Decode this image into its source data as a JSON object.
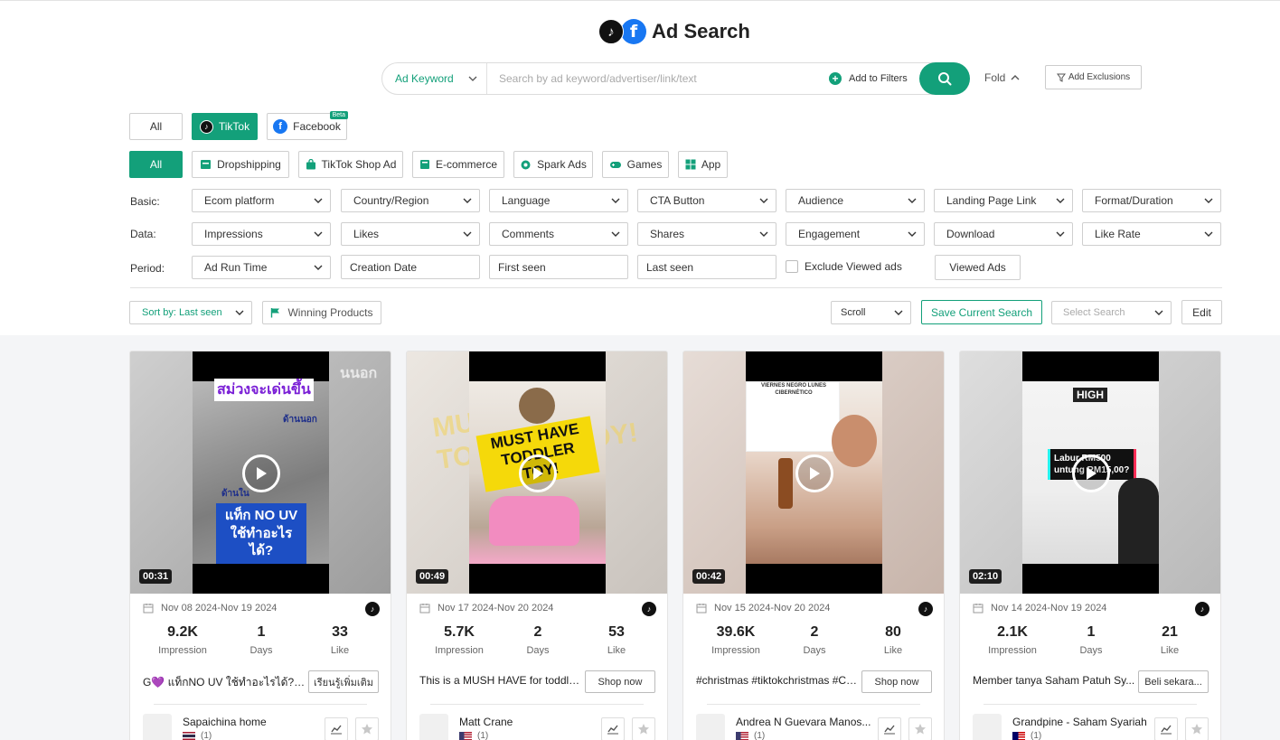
{
  "header": {
    "title": "Ad Search"
  },
  "search": {
    "type_label": "Ad Keyword",
    "placeholder": "Search by ad keyword/advertiser/link/text",
    "add_filters": "Add to Filters",
    "fold": "Fold",
    "add_exclusions": "Add Exclusions"
  },
  "platforms": {
    "all": "All",
    "tiktok": "TikTok",
    "facebook": "Facebook",
    "beta": "Beta"
  },
  "categories": {
    "all": "All",
    "dropshipping": "Dropshipping",
    "tiktok_shop": "TikTok Shop Ad",
    "ecommerce": "E-commerce",
    "spark": "Spark Ads",
    "games": "Games",
    "app": "App"
  },
  "filters": {
    "basic_label": "Basic:",
    "basic": [
      "Ecom platform",
      "Country/Region",
      "Language",
      "CTA Button",
      "Audience",
      "Landing Page Link",
      "Format/Duration"
    ],
    "data_label": "Data:",
    "data": [
      "Impressions",
      "Likes",
      "Comments",
      "Shares",
      "Engagement",
      "Download",
      "Like Rate"
    ],
    "period_label": "Period:",
    "period_run_time": "Ad Run Time",
    "creation_date": "Creation Date",
    "first_seen": "First seen",
    "last_seen": "Last seen",
    "exclude_viewed": "Exclude Viewed ads",
    "viewed_ads": "Viewed Ads"
  },
  "toolbar": {
    "sort": "Sort by: Last seen",
    "winning": "Winning Products",
    "scroll": "Scroll",
    "save": "Save Current Search",
    "select_search": "Select Search",
    "edit": "Edit"
  },
  "stat_labels": {
    "impression": "Impression",
    "days": "Days",
    "like": "Like"
  },
  "cards": [
    {
      "duration": "00:31",
      "date_range": "Nov 08 2024-Nov 19 2024",
      "impressions": "9.2K",
      "days": "1",
      "likes": "33",
      "description": "G💜 แท็กNO UV ใช้ทำอะไรได้? ...",
      "cta": "เรียนรู้เพิ่มเติม",
      "advertiser": "Sapaichina home",
      "ad_count": "(1)",
      "overlay_top": "สม่วงจะเด่นขึ้น",
      "overlay_mid": "ด้านนอก",
      "overlay_in": "ด้านใน",
      "overlay_bottom": "แท็ก NO UV ใช้ทำอะไรได้?",
      "bg_text": "นนอก"
    },
    {
      "duration": "00:49",
      "date_range": "Nov 17 2024-Nov 20 2024",
      "impressions": "5.7K",
      "days": "2",
      "likes": "53",
      "description": "This is a MUSH HAVE for toddlers...",
      "cta": "Shop now",
      "advertiser": "Matt Crane",
      "ad_count": "(1)",
      "overlay_top": "MUST HAVE TODDLER TOY!",
      "bg_text": "MUST HAVE TODDLER TOY!"
    },
    {
      "duration": "00:42",
      "date_range": "Nov 15 2024-Nov 20 2024",
      "impressions": "39.6K",
      "days": "2",
      "likes": "80",
      "description": "#christmas #tiktokchristmas #Cyb...",
      "cta": "Shop now",
      "advertiser": "Andrea N Guevara Manos...",
      "ad_count": "(1)",
      "overlay_top": "VIERNES NEGRO LUNES CIBERNÉTICO"
    },
    {
      "duration": "02:10",
      "date_range": "Nov 14 2024-Nov 19 2024",
      "impressions": "2.1K",
      "days": "1",
      "likes": "21",
      "description": "Member tanya Saham Patuh Sy...",
      "cta": "Beli sekara...",
      "advertiser": "Grandpine - Saham Syariah",
      "ad_count": "(1)",
      "overlay_top": "HIGH",
      "overlay_mid": "Labur RM500 untung RM15,00?"
    }
  ],
  "colors": {
    "accent": "#13a07a",
    "tiktok": "#111111",
    "facebook": "#1877f2"
  }
}
